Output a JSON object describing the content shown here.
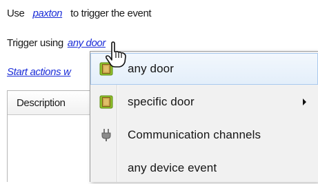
{
  "trigger": {
    "use_label": "Use",
    "device_link": "paxton",
    "event_text": "to trigger the event",
    "trigger_label": "Trigger using",
    "trigger_link": "any door",
    "actions_link": "Start actions w"
  },
  "table": {
    "description_header": "Description"
  },
  "context_menu": {
    "items": [
      {
        "label": "any door",
        "icon": "door-icon"
      },
      {
        "label": "specific door",
        "icon": "door-icon",
        "has_submenu": true
      },
      {
        "label": "Communication channels",
        "icon": "plug-icon"
      },
      {
        "label": "any device event",
        "icon": ""
      }
    ]
  },
  "colors": {
    "link": "#1c2ed8",
    "highlight": "#e3eefa",
    "door_icon_frame": "#8fbf2a",
    "door_icon_fill": "#c9a24a"
  }
}
